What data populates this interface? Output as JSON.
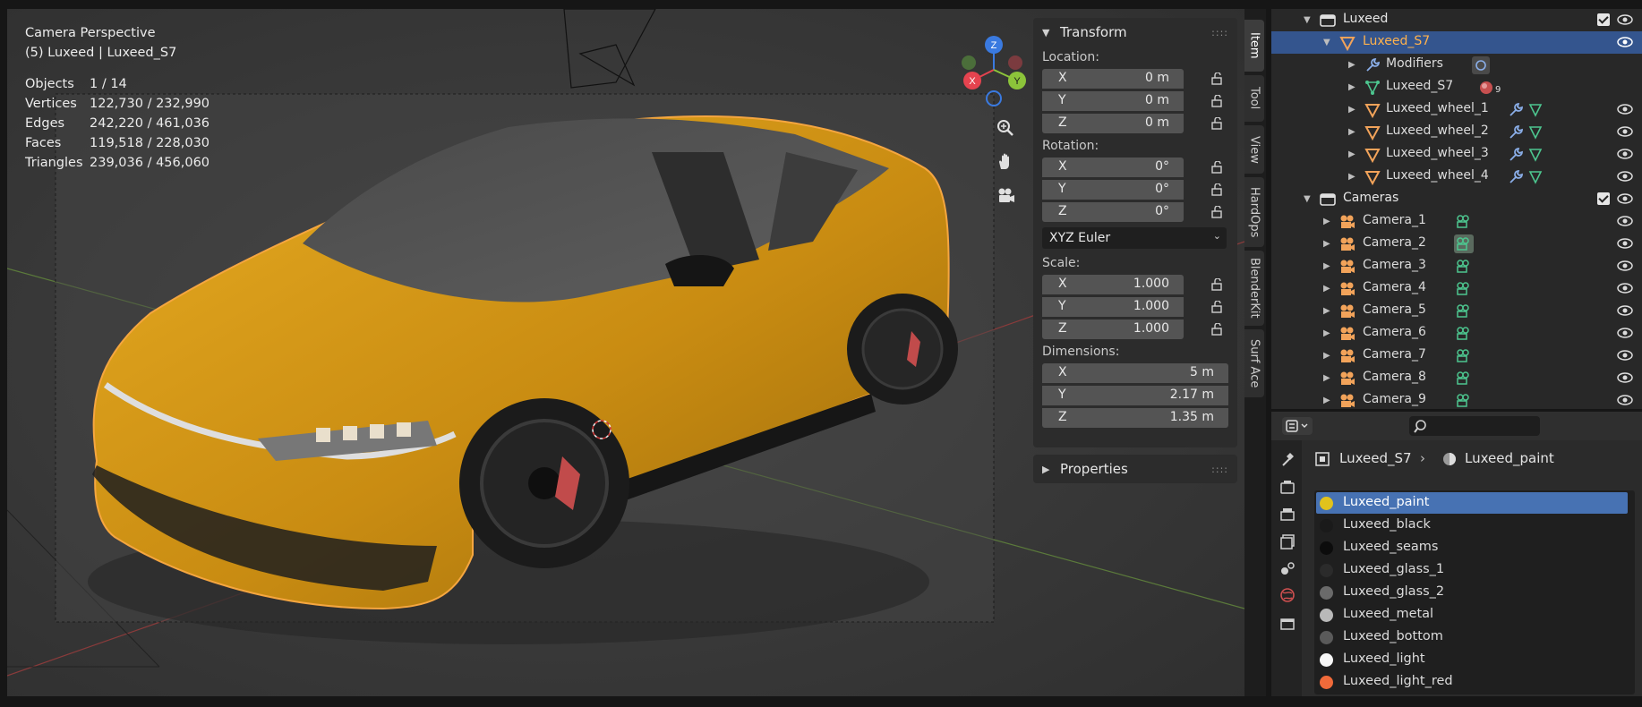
{
  "viewport": {
    "title": "Camera Perspective",
    "subtitle": "(5) Luxeed | Luxeed_S7",
    "stats": [
      {
        "label": "Objects",
        "value": "1 / 14"
      },
      {
        "label": "Vertices",
        "value": "122,730 / 232,990"
      },
      {
        "label": "Edges",
        "value": "242,220 / 461,036"
      },
      {
        "label": "Faces",
        "value": "119,518 / 228,030"
      },
      {
        "label": "Triangles",
        "value": "239,036 / 456,060"
      }
    ],
    "gizmo": {
      "x": "X",
      "y": "Y",
      "z": "Z",
      "colors": {
        "x": "#e5434f",
        "y": "#8cc43a",
        "z": "#3a7ae0"
      }
    },
    "nav_icons": [
      "zoom-icon",
      "hand-pan-icon",
      "camera-view-icon"
    ]
  },
  "npanel": {
    "transform_title": "Transform",
    "location_label": "Location:",
    "location": [
      {
        "axis": "X",
        "value": "0 m"
      },
      {
        "axis": "Y",
        "value": "0 m"
      },
      {
        "axis": "Z",
        "value": "0 m"
      }
    ],
    "rotation_label": "Rotation:",
    "rotation": [
      {
        "axis": "X",
        "value": "0°"
      },
      {
        "axis": "Y",
        "value": "0°"
      },
      {
        "axis": "Z",
        "value": "0°"
      }
    ],
    "rotation_mode": "XYZ Euler",
    "scale_label": "Scale:",
    "scale": [
      {
        "axis": "X",
        "value": "1.000"
      },
      {
        "axis": "Y",
        "value": "1.000"
      },
      {
        "axis": "Z",
        "value": "1.000"
      }
    ],
    "dimensions_label": "Dimensions:",
    "dimensions": [
      {
        "axis": "X",
        "value": "5 m"
      },
      {
        "axis": "Y",
        "value": "2.17 m"
      },
      {
        "axis": "Z",
        "value": "1.35 m"
      }
    ],
    "properties_title": "Properties"
  },
  "tabs": [
    "Item",
    "Tool",
    "View",
    "HardOps",
    "BlenderKit",
    "Surf Ace"
  ],
  "outliner": {
    "rows": [
      {
        "label": "Luxeed",
        "type": "collection"
      },
      {
        "label": "Luxeed_S7",
        "type": "mesh",
        "selected": true
      },
      {
        "label": "Modifiers",
        "type": "modifiers"
      },
      {
        "label": "Luxeed_S7",
        "type": "mesh-data"
      },
      {
        "label": "Luxeed_wheel_1",
        "type": "mesh"
      },
      {
        "label": "Luxeed_wheel_2",
        "type": "mesh"
      },
      {
        "label": "Luxeed_wheel_3",
        "type": "mesh"
      },
      {
        "label": "Luxeed_wheel_4",
        "type": "mesh"
      },
      {
        "label": "Cameras",
        "type": "collection"
      },
      {
        "label": "Camera_1",
        "type": "camera"
      },
      {
        "label": "Camera_2",
        "type": "camera"
      },
      {
        "label": "Camera_3",
        "type": "camera"
      },
      {
        "label": "Camera_4",
        "type": "camera"
      },
      {
        "label": "Camera_5",
        "type": "camera"
      },
      {
        "label": "Camera_6",
        "type": "camera"
      },
      {
        "label": "Camera_7",
        "type": "camera"
      },
      {
        "label": "Camera_8",
        "type": "camera"
      },
      {
        "label": "Camera_9",
        "type": "camera"
      }
    ],
    "mesh_data_badge": "9"
  },
  "properties": {
    "breadcrumb_object": "Luxeed_S7",
    "breadcrumb_material": "Luxeed_paint",
    "materials": [
      {
        "name": "Luxeed_paint",
        "color": "#e1c21d",
        "selected": true
      },
      {
        "name": "Luxeed_black",
        "color": "#1a1a1a"
      },
      {
        "name": "Luxeed_seams",
        "color": "#0c0c0c"
      },
      {
        "name": "Luxeed_glass_1",
        "color": "#2b2b2b"
      },
      {
        "name": "Luxeed_glass_2",
        "color": "#6a6a6a"
      },
      {
        "name": "Luxeed_metal",
        "color": "#b9b9b9"
      },
      {
        "name": "Luxeed_bottom",
        "color": "#5a5a5a"
      },
      {
        "name": "Luxeed_light",
        "color": "#f7f7f7"
      },
      {
        "name": "Luxeed_light_red",
        "color": "#f06a3a"
      }
    ]
  },
  "colors": {
    "accent_selection": "#34558e",
    "material_selected": "#4772b3",
    "car_paint": "#d99a1b",
    "outline": "#f5a640"
  }
}
